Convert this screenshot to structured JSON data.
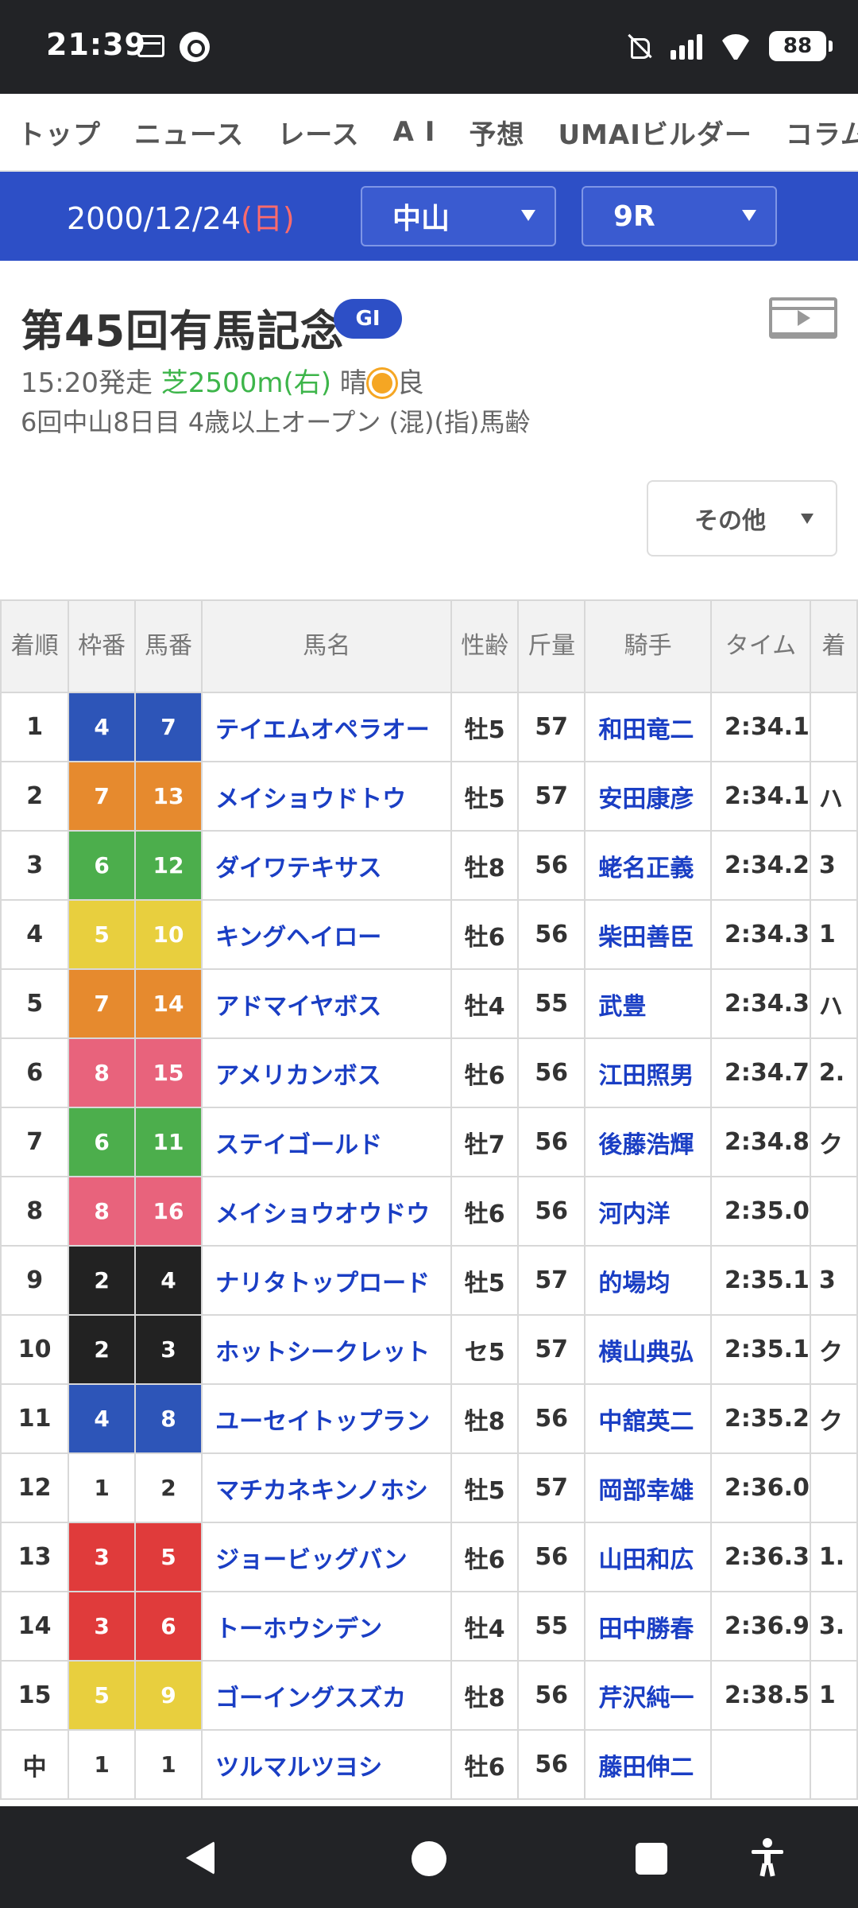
{
  "status_bar": {
    "time": "21:39",
    "battery": "88",
    "icons": [
      "mail-icon",
      "link-icon",
      "mute-icon",
      "signal-icon",
      "wifi-icon",
      "battery-icon"
    ]
  },
  "top_nav": {
    "items": [
      "トップ",
      "ニュース",
      "レース",
      "A I",
      "予想",
      "UMAIビルダー",
      "コラム"
    ]
  },
  "date_bar": {
    "date": "2000/12/24",
    "dow": "(日)",
    "dow_color": "#ff6b6b",
    "venue": "中山",
    "race_no": "9R"
  },
  "race": {
    "title": "第45回有馬記念",
    "grade": "GI",
    "start": "15:20発走",
    "course": "芝2500m(右)",
    "weather": "晴",
    "track": "良",
    "conditions": "6回中山8日目 4歳以上オープン (混)(指)馬齢"
  },
  "other_button": "その他",
  "table": {
    "headers": [
      "着順",
      "枠番",
      "馬番",
      "馬名",
      "性齢",
      "斤量",
      "騎手",
      "タイム",
      "着"
    ],
    "waku_colors": {
      "1": {
        "bg": "#ffffff",
        "fg": "#333333"
      },
      "2": {
        "bg": "#222222",
        "fg": "#ffffff"
      },
      "3": {
        "bg": "#e03b3b",
        "fg": "#ffffff"
      },
      "4": {
        "bg": "#2d55b8",
        "fg": "#ffffff"
      },
      "5": {
        "bg": "#e8cf3e",
        "fg": "#ffffff"
      },
      "6": {
        "bg": "#4cae4c",
        "fg": "#ffffff"
      },
      "7": {
        "bg": "#e68a2e",
        "fg": "#ffffff"
      },
      "8": {
        "bg": "#e8637c",
        "fg": "#ffffff"
      }
    },
    "rows": [
      {
        "rank": "1",
        "waku": "4",
        "num": "7",
        "horse": "テイエムオペラオー",
        "sex_age": "牡5",
        "weight": "57",
        "jockey": "和田竜二",
        "time": "2:34.1",
        "margin": ""
      },
      {
        "rank": "2",
        "waku": "7",
        "num": "13",
        "horse": "メイショウドトウ",
        "sex_age": "牡5",
        "weight": "57",
        "jockey": "安田康彦",
        "time": "2:34.1",
        "margin": "ハ"
      },
      {
        "rank": "3",
        "waku": "6",
        "num": "12",
        "horse": "ダイワテキサス",
        "sex_age": "牡8",
        "weight": "56",
        "jockey": "蛯名正義",
        "time": "2:34.2",
        "margin": "3"
      },
      {
        "rank": "4",
        "waku": "5",
        "num": "10",
        "horse": "キングヘイロー",
        "sex_age": "牡6",
        "weight": "56",
        "jockey": "柴田善臣",
        "time": "2:34.3",
        "margin": "1"
      },
      {
        "rank": "5",
        "waku": "7",
        "num": "14",
        "horse": "アドマイヤボス",
        "sex_age": "牡4",
        "weight": "55",
        "jockey": "武豊",
        "time": "2:34.3",
        "margin": "ハ"
      },
      {
        "rank": "6",
        "waku": "8",
        "num": "15",
        "horse": "アメリカンボス",
        "sex_age": "牡6",
        "weight": "56",
        "jockey": "江田照男",
        "time": "2:34.7",
        "margin": "2."
      },
      {
        "rank": "7",
        "waku": "6",
        "num": "11",
        "horse": "ステイゴールド",
        "sex_age": "牡7",
        "weight": "56",
        "jockey": "後藤浩輝",
        "time": "2:34.8",
        "margin": "ク"
      },
      {
        "rank": "8",
        "waku": "8",
        "num": "16",
        "horse": "メイショウオウドウ",
        "sex_age": "牡6",
        "weight": "56",
        "jockey": "河内洋",
        "time": "2:35.0",
        "margin": ""
      },
      {
        "rank": "9",
        "waku": "2",
        "num": "4",
        "horse": "ナリタトップロード",
        "sex_age": "牡5",
        "weight": "57",
        "jockey": "的場均",
        "time": "2:35.1",
        "margin": "3"
      },
      {
        "rank": "10",
        "waku": "2",
        "num": "3",
        "horse": "ホットシークレット",
        "sex_age": "セ5",
        "weight": "57",
        "jockey": "横山典弘",
        "time": "2:35.1",
        "margin": "ク"
      },
      {
        "rank": "11",
        "waku": "4",
        "num": "8",
        "horse": "ユーセイトップラン",
        "sex_age": "牡8",
        "weight": "56",
        "jockey": "中舘英二",
        "time": "2:35.2",
        "margin": "ク"
      },
      {
        "rank": "12",
        "waku": "1",
        "num": "2",
        "horse": "マチカネキンノホシ",
        "sex_age": "牡5",
        "weight": "57",
        "jockey": "岡部幸雄",
        "time": "2:36.0",
        "margin": ""
      },
      {
        "rank": "13",
        "waku": "3",
        "num": "5",
        "horse": "ジョービッグバン",
        "sex_age": "牡6",
        "weight": "56",
        "jockey": "山田和広",
        "time": "2:36.3",
        "margin": "1."
      },
      {
        "rank": "14",
        "waku": "3",
        "num": "6",
        "horse": "トーホウシデン",
        "sex_age": "牡4",
        "weight": "55",
        "jockey": "田中勝春",
        "time": "2:36.9",
        "margin": "3."
      },
      {
        "rank": "15",
        "waku": "5",
        "num": "9",
        "horse": "ゴーイングスズカ",
        "sex_age": "牡8",
        "weight": "56",
        "jockey": "芹沢純一",
        "time": "2:38.5",
        "margin": "1"
      },
      {
        "rank": "中",
        "waku": "1",
        "num": "1",
        "horse": "ツルマルツヨシ",
        "sex_age": "牡6",
        "weight": "56",
        "jockey": "藤田伸二",
        "time": "",
        "margin": ""
      }
    ]
  }
}
